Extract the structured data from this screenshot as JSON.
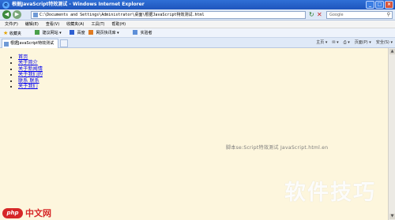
{
  "window": {
    "title": "根据JavaScript特效测试 - Windows Internet Explorer",
    "controls": [
      "_",
      "□",
      "×"
    ]
  },
  "toolbar": {
    "address": "C:\\Documents and Settings\\Administrator\\桌面\\根据JavaScript特效测试.html",
    "search_placeholder": "Google"
  },
  "menu": [
    "文件(F)",
    "编辑(E)",
    "查看(V)",
    "收藏夹(A)",
    "工具(T)",
    "帮助(H)"
  ],
  "favorites_bar": {
    "favorites_label": "收藏夹",
    "items": [
      "建议网站 ▾",
      "百度",
      "网页快讯库 ▾",
      "实验者"
    ]
  },
  "tabs": {
    "active_tab": "根据JavaScript特效测试",
    "tools": [
      "主页 ▾",
      "✉ ▾",
      "⎙ ▾",
      "页面(P) ▾",
      "安全(S) ▾"
    ]
  },
  "content": {
    "nav_links": [
      "首页",
      "关于简介",
      "关于新闻情",
      "关于我们的",
      "联系 联系",
      "关于我们"
    ],
    "footer_text": "脚本se:Script特效测试 JavaScript.html.en"
  },
  "watermarks": {
    "right": "软件技巧",
    "left_badge": "php",
    "left_text": "中文网"
  },
  "colors": {
    "content_bg": "#fdf6dd",
    "link": "#0000ee",
    "titlebar": "#1e55bd"
  }
}
